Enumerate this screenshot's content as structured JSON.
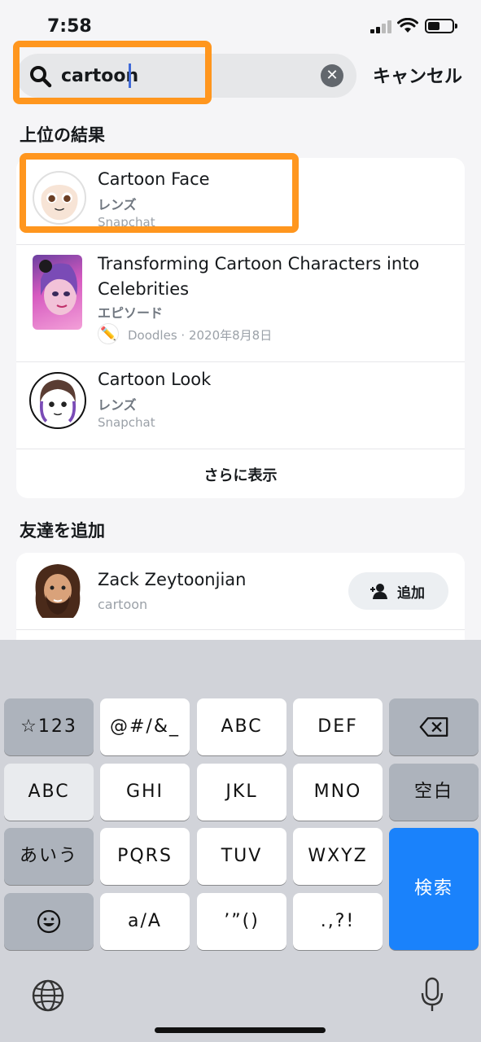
{
  "status": {
    "time": "7:58"
  },
  "search": {
    "value": "cartoon",
    "cancel_label": "キャンセル"
  },
  "top_results": {
    "heading": "上位の結果",
    "items": [
      {
        "title": "Cartoon Face",
        "type": "レンズ",
        "meta": "Snapchat"
      },
      {
        "title": "Transforming Cartoon Characters into Celebrities",
        "title_line1": "Transforming Cartoon Characters into",
        "title_line2": "Celebrities",
        "type": "エピソード",
        "meta": "Doodles · 2020年8月8日"
      },
      {
        "title": "Cartoon Look",
        "type": "レンズ",
        "meta": "Snapchat"
      }
    ],
    "show_more": "さらに表示"
  },
  "add_friends": {
    "heading": "友達を追加",
    "items": [
      {
        "name": "Zack Zeytoonjian",
        "username": "cartoon",
        "add_label": "追加"
      }
    ]
  },
  "keyboard": {
    "rows": [
      [
        "☆123",
        "@#/&_",
        "ABC",
        "DEF",
        "⌫"
      ],
      [
        "ABC",
        "GHI",
        "JKL",
        "MNO",
        "空白"
      ],
      [
        "あいう",
        "PQRS",
        "TUV",
        "WXYZ",
        "検索"
      ],
      [
        "☺",
        "a/A",
        "’”()",
        ".,?!"
      ]
    ],
    "k": {
      "r0c0": "☆123",
      "r0c1": "@#/&_",
      "r0c2": "ABC",
      "r0c3": "DEF",
      "r1c0": "ABC",
      "r1c1": "GHI",
      "r1c2": "JKL",
      "r1c3": "MNO",
      "r1c4": "空白",
      "r2c0": "あいう",
      "r2c1": "PQRS",
      "r2c2": "TUV",
      "r2c3": "WXYZ",
      "r2c4": "検索",
      "r3c1": "a/A",
      "r3c2": "’”()",
      "r3c3": ".,?!"
    }
  },
  "colors": {
    "highlight": "#ff961e",
    "accent": "#1a82fb",
    "caret": "#3f6ad8"
  }
}
